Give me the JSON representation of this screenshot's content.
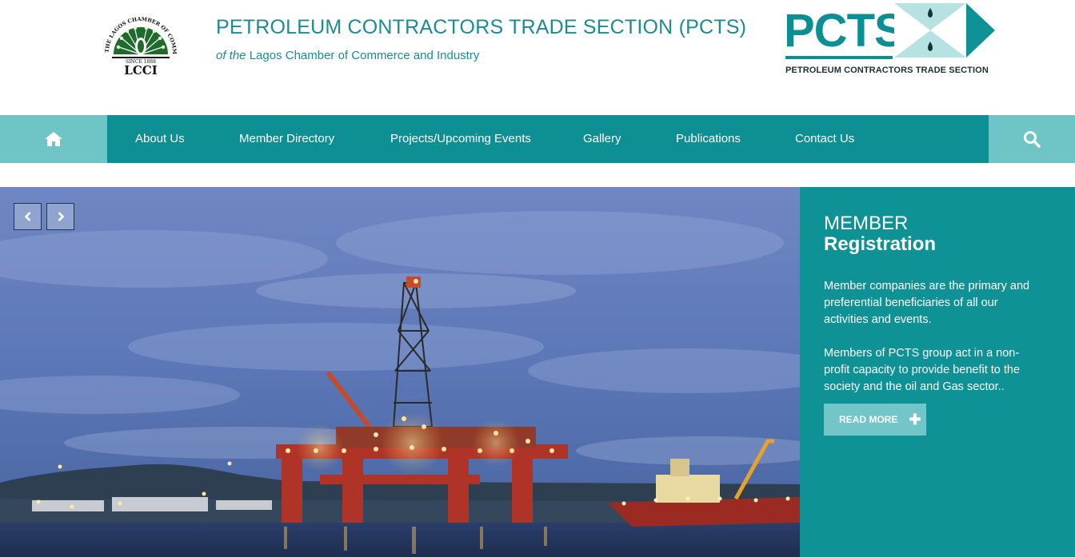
{
  "header": {
    "lcci_logo": {
      "ring_text": "THE LAGOS CHAMBER OF COMMERCE & INDUSTRY",
      "since": "SINCE 1888",
      "abbr": "LCCI"
    },
    "title_main": "PETROLEUM CONTRACTORS TRADE SECTION",
    "title_abbr": " (PCTS)",
    "subtitle_prefix": "of the",
    "subtitle_org": " Lagos Chamber of Commerce and Industry",
    "pcts_logo": {
      "word": "PCTS",
      "tagline": "PETROLEUM CONTRACTORS TRADE SECTION"
    }
  },
  "nav": {
    "home_icon": "home-icon",
    "items": [
      {
        "label": "About Us"
      },
      {
        "label": "Member Directory"
      },
      {
        "label": "Projects/Upcoming Events"
      },
      {
        "label": "Gallery"
      },
      {
        "label": "Publications"
      },
      {
        "label": "Contact Us"
      }
    ],
    "search_icon": "search-icon"
  },
  "slider": {
    "prev_icon": "chevron-left-icon",
    "next_icon": "chevron-right-icon",
    "image": "offshore-oil-rig-at-dusk"
  },
  "panel": {
    "heading_line1": "MEMBER",
    "heading_line2": "Registration",
    "paragraph1": "Member companies are the primary and preferential beneficiaries of all our activities and events.",
    "paragraph2": "Members of PCTS group act in a non-profit capacity to provide benefit to the society and the oil and Gas sector..",
    "button_label": "READ MORE",
    "button_icon": "plus-icon"
  },
  "colors": {
    "teal": "#0e8f94",
    "light_teal": "#6fc4c6",
    "panel_teal": "#0e9296"
  }
}
